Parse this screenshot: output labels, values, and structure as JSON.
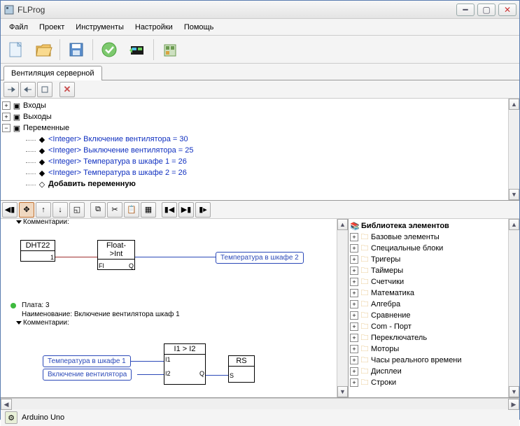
{
  "window": {
    "title": "FLProg"
  },
  "menu": [
    "Файл",
    "Проект",
    "Инструменты",
    "Настройки",
    "Помощь"
  ],
  "tab": {
    "label": "Вентиляция серверной"
  },
  "tree": {
    "roots": [
      "Входы",
      "Выходы",
      "Переменные"
    ],
    "vars": [
      "<Integer> Включение вентилятора = 30",
      "<Integer> Выключение вентилятора = 25",
      "<Integer> Температура в шкафе 1 = 26",
      "<Integer> Температура в шкафе 2 = 26"
    ],
    "add": "Добавить переменную"
  },
  "library": {
    "header": "Библиотека элементов",
    "items": [
      "Базовые элементы",
      "Специальные блоки",
      "Тригеры",
      "Таймеры",
      "Счетчики",
      "Математика",
      "Алгебра",
      "Сравнение",
      "Com - Порт",
      "Переключатель",
      "Моторы",
      "Часы реального времени",
      "Дисплеи",
      "Строки"
    ]
  },
  "canvas": {
    "comments_label": "Комментарии:",
    "dht": "DHT22",
    "floatint": "Float->Int",
    "temp2": "Температура в шкафе 2",
    "plate": "Плата: 3",
    "name": "Наименование: Включение вентилятора шкаф 1",
    "temp1": "Температура в шкафе 1",
    "fan_on": "Включение вентилятора",
    "cmp": "I1 > I2",
    "rs": "RS",
    "port_i1": "I1",
    "port_i2": "I2",
    "port_q": "Q",
    "port_s": "S",
    "port_fl": "Fl",
    "port_1": "1"
  },
  "status": {
    "board": "Arduino Uno"
  }
}
